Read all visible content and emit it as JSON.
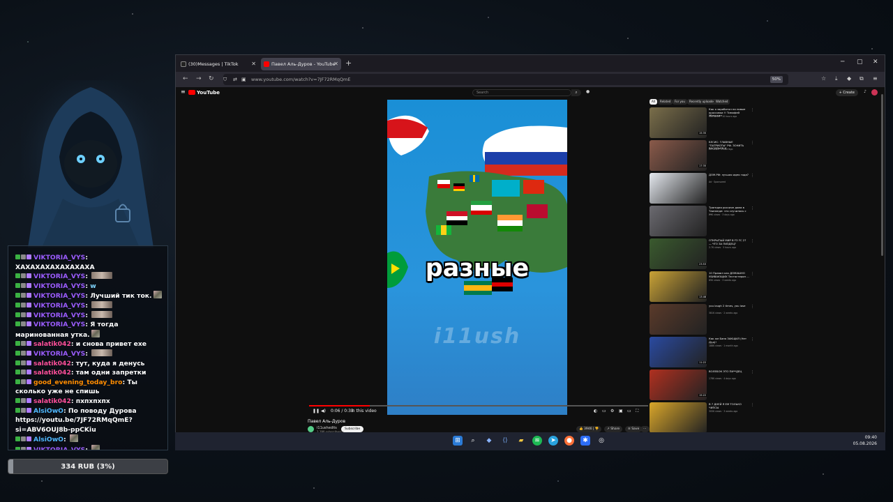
{
  "chat": {
    "messages": [
      {
        "user": "VIKTORIA_VYS",
        "color": "#9b5cff",
        "text": "ХАХАХАХАХАХАХАХА",
        "emote": ""
      },
      {
        "user": "VIKTORIA_VYS",
        "color": "#9b5cff",
        "text": "",
        "emote": "wide"
      },
      {
        "user": "VIKTORIA_VYS",
        "color": "#9b5cff",
        "text": "w",
        "emote": ""
      },
      {
        "user": "VIKTORIA_VYS",
        "color": "#9b5cff",
        "text": "Лучший тик ток.",
        "emote": "small"
      },
      {
        "user": "VIKTORIA_VYS",
        "color": "#9b5cff",
        "text": "",
        "emote": "wide"
      },
      {
        "user": "VIKTORIA_VYS",
        "color": "#9b5cff",
        "text": "",
        "emote": "wide"
      },
      {
        "user": "VIKTORIA_VYS",
        "color": "#9b5cff",
        "text": "Я тогда маринованная утка.",
        "emote": "small"
      },
      {
        "user": "salatik042",
        "color": "#ff4f9a",
        "text": "и снова привет exe",
        "emote": ""
      },
      {
        "user": "VIKTORIA_VYS",
        "color": "#9b5cff",
        "text": "",
        "emote": "wide"
      },
      {
        "user": "salatik042",
        "color": "#ff4f9a",
        "text": "тут, куда я денусь",
        "emote": ""
      },
      {
        "user": "salatik042",
        "color": "#ff4f9a",
        "text": "там одни запретки",
        "emote": ""
      },
      {
        "user": "good_evening_today_bro",
        "color": "#ff8c00",
        "text": "Ты сколько уже не спишь",
        "emote": ""
      },
      {
        "user": "salatik042",
        "color": "#ff4f9a",
        "text": "пхпхпхпх",
        "emote": ""
      },
      {
        "user": "AlsiOwO",
        "color": "#4fb8ff",
        "text": "По поводу Дурова https://youtu.be/7JF72RMqQmE?si=ABV6OUJ8b-ppCKiu",
        "emote": ""
      },
      {
        "user": "AlsiOwO",
        "color": "#4fb8ff",
        "text": "",
        "emote": "small"
      },
      {
        "user": "VIKTORIA_VYS",
        "color": "#9b5cff",
        "text": "",
        "emote": "small"
      }
    ]
  },
  "donation": {
    "label": "334 RUB (3%)",
    "fraction": 0.03
  },
  "browser": {
    "tabs": [
      {
        "label": "(30)Messages | TikTok",
        "active": false
      },
      {
        "label": "Павел Аль-Дуров - YouTube",
        "active": true
      }
    ],
    "url": "www.youtube.com/watch?v=7JF72RMqQmE",
    "zoom": "50%"
  },
  "youtube": {
    "logo": "YouTube",
    "search_placeholder": "Search",
    "create_label": "+ Create",
    "video": {
      "caption": "разные",
      "watermark": "i11ush",
      "time": "0:06 / 0:33",
      "mode": "In this video",
      "progress": 0.18,
      "title": "Павел Аль-Дуров",
      "channel": "i11ushedits",
      "subs": "2,190 subscribers",
      "subscribe": "Subscribe",
      "likes": "3946",
      "share": "Share",
      "save": "Save"
    },
    "chips": [
      "All",
      "Related",
      "For you",
      "Recently uploaded",
      "Watched"
    ],
    "recommendations": [
      {
        "title": "Как я заработал на новые кроссовки !! Тимофей Жмуркин",
        "meta": "56K views · 10 hours ago",
        "duration": "15:35",
        "color": "#7a6e4a"
      },
      {
        "title": "БЕСИС: ГЛАВНЫЕ \"ПАТРИОТЫ\" РФ. ЗОНИТЬ ВАСИЛЬЕВ И ...",
        "meta": "2K views · 1 hour ago",
        "duration": "17:35",
        "color": "#8a5a4a"
      },
      {
        "title": "ДОМ.РФ: лучшая идея года?",
        "meta": "Ad · Sponsored",
        "duration": "",
        "color": "#e4e8ee"
      },
      {
        "title": "Трагедия россиян дома в Таиланде: что случилось с ...",
        "meta": "29K views · 3 days ago",
        "duration": "",
        "color": "#6b6a70"
      },
      {
        "title": "ОТКРЫТЫЙ МИР В F3 FC 27 — ЧТО ЗА ПИЗДЕЦ?",
        "meta": "2.7K views · 5 hours ago",
        "duration": "23:53",
        "color": "#3a5a2e"
      },
      {
        "title": "10 Правил как ДОМАШНО УБИВАЮЩИХ Тестостерон ...",
        "meta": "85K views · 3 weeks ago",
        "duration": "13:46",
        "color": "#c9a236"
      },
      {
        "title": "you laugh 2 times, you lose",
        "meta": "381K views · 2 weeks ago",
        "duration": "",
        "color": "#5a3a2a"
      },
      {
        "title": "Как же Баня ЗАКЩИЛ (Нет Дуд)!",
        "meta": "188K views · 1 month ago",
        "duration": "11:22",
        "color": "#2a4aa0"
      },
      {
        "title": "ВОЛЕБОК ЭТО ПИ**ДЕЦ",
        "meta": "178K views · 4 days ago",
        "duration": "15:22",
        "color": "#b03020"
      },
      {
        "title": "В 7 ДНЕЙ Я ЕМ ТОЛЬКО ЧИПСЫ",
        "meta": "305K views · 3 weeks ago",
        "duration": "",
        "color": "#d9a62a"
      }
    ]
  },
  "taskbar": {
    "time": "09:40",
    "date": "05.08.2026"
  }
}
